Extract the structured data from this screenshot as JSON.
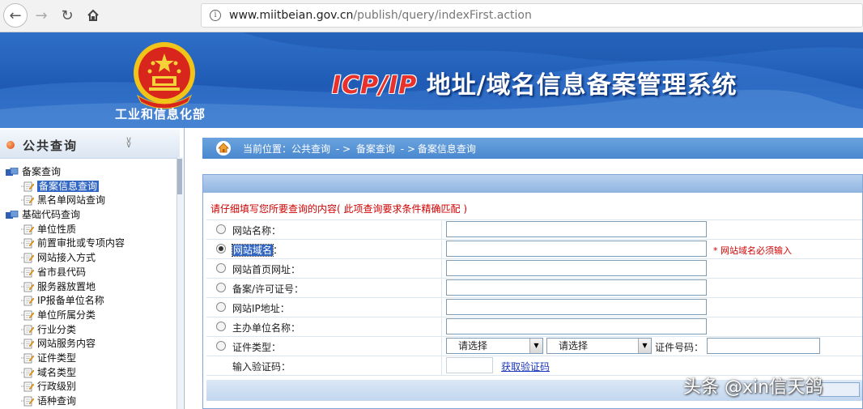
{
  "browser": {
    "url_host": "www.miitbeian.gov.cn",
    "url_path": "/publish/query/indexFirst.action"
  },
  "header": {
    "ministry": "工业和信息化部",
    "title_icp": "ICP/IP",
    "title_rest": " 地址/域名信息备案管理系统"
  },
  "sidebar": {
    "title": "公共查询",
    "items": [
      {
        "label": "备案查询",
        "kind": "group"
      },
      {
        "label": "备案信息查询",
        "kind": "leaf",
        "active": true
      },
      {
        "label": "黑名单网站查询",
        "kind": "leaf"
      },
      {
        "label": "基础代码查询",
        "kind": "group"
      },
      {
        "label": "单位性质",
        "kind": "leaf"
      },
      {
        "label": "前置审批或专项内容",
        "kind": "leaf"
      },
      {
        "label": "网站接入方式",
        "kind": "leaf"
      },
      {
        "label": "省市县代码",
        "kind": "leaf"
      },
      {
        "label": "服务器放置地",
        "kind": "leaf"
      },
      {
        "label": "IP报备单位名称",
        "kind": "leaf"
      },
      {
        "label": "单位所属分类",
        "kind": "leaf"
      },
      {
        "label": "行业分类",
        "kind": "leaf"
      },
      {
        "label": "网站服务内容",
        "kind": "leaf"
      },
      {
        "label": "证件类型",
        "kind": "leaf"
      },
      {
        "label": "域名类型",
        "kind": "leaf"
      },
      {
        "label": "行政级别",
        "kind": "leaf"
      },
      {
        "label": "语种查询",
        "kind": "leaf"
      }
    ]
  },
  "breadcrumb": {
    "prefix": "当前位置：公共查询",
    "sep1": "- >",
    "mid": "备案查询",
    "sep2": "- >",
    "last": "备案信息查询"
  },
  "form": {
    "notice": "请仔细填写您所要查询的内容( 此项查询要求条件精确匹配 )",
    "fields": [
      {
        "label": "网站名称：",
        "selected": false
      },
      {
        "label": "网站域名",
        "suffix": "：",
        "selected": true,
        "required_note": "* 网站域名必须输入"
      },
      {
        "label": "网站首页网址：",
        "selected": false
      },
      {
        "label": "备案/许可证号：",
        "selected": false
      },
      {
        "label": "网站IP地址：",
        "selected": false
      },
      {
        "label": "主办单位名称：",
        "selected": false
      },
      {
        "label": "证件类型：",
        "selected": false
      }
    ],
    "cert_select_1": "请选择",
    "cert_select_2": "请选择",
    "cert_number_label": "证件号码：",
    "captcha_label": "输入验证码：",
    "captcha_link": "获取验证码"
  },
  "watermark": "头条 @xin信天鸽",
  "colors": {
    "banner": "#2a68c2",
    "notice": "#d10000",
    "link": "#1a35b8",
    "selection": "#3166c4"
  }
}
